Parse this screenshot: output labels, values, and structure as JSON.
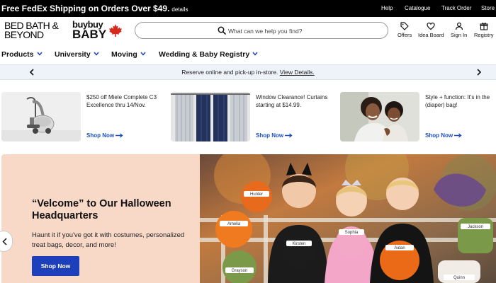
{
  "topbar": {
    "promo": "Free FedEx Shipping on Orders Over $49.",
    "details": "details",
    "links": [
      "Help",
      "Catalogue",
      "Track Order",
      "Store"
    ]
  },
  "header": {
    "logo_line1": "BED BATH &",
    "logo_line2": "BEYOND",
    "baby_line1": "buybuy",
    "baby_line2": "BABY",
    "search_placeholder": "What can we help you find?",
    "icons": [
      {
        "label": "Offers",
        "icon": "tag-icon"
      },
      {
        "label": "Idea Board",
        "icon": "heart-icon"
      },
      {
        "label": "Sign In",
        "icon": "user-icon"
      },
      {
        "label": "Registry",
        "icon": "gift-icon"
      }
    ]
  },
  "nav": {
    "items": [
      "Products",
      "University",
      "Moving",
      "Wedding & Baby Registry"
    ]
  },
  "pickup": {
    "text": "Reserve online and pick-up in-store.",
    "link": "View Details."
  },
  "cards": [
    {
      "text": "$250 off Miele Complete C3 Excellence thru 14/Nov.",
      "cta": "Shop Now",
      "image": "vacuum-cleaner"
    },
    {
      "text": "Window Clearance! Curtains starting at $14.99.",
      "cta": "Shop Now",
      "image": "curtains"
    },
    {
      "text": "Style + function: It's in the (diaper) bag!",
      "cta": "Shop Now",
      "image": "mother-and-child"
    }
  ],
  "hero": {
    "title": "“Velcome” to Our Halloween Headquarters",
    "body": "Haunt it if you've got it with costumes, personalized treat bags, decor, and more!",
    "cta": "Shop Now",
    "bag_names": [
      "Hunter",
      "Amelia",
      "Sophia",
      "Kirsten",
      "Aidan",
      "Jackson",
      "Grayson",
      "Quinn"
    ]
  },
  "colors": {
    "topbar_bg": "#000000",
    "accent_blue": "#1d3fbb",
    "link_blue": "#1a4fbf",
    "hero_peach": "#f8d9c8",
    "strip_bg": "#eef2f9"
  }
}
